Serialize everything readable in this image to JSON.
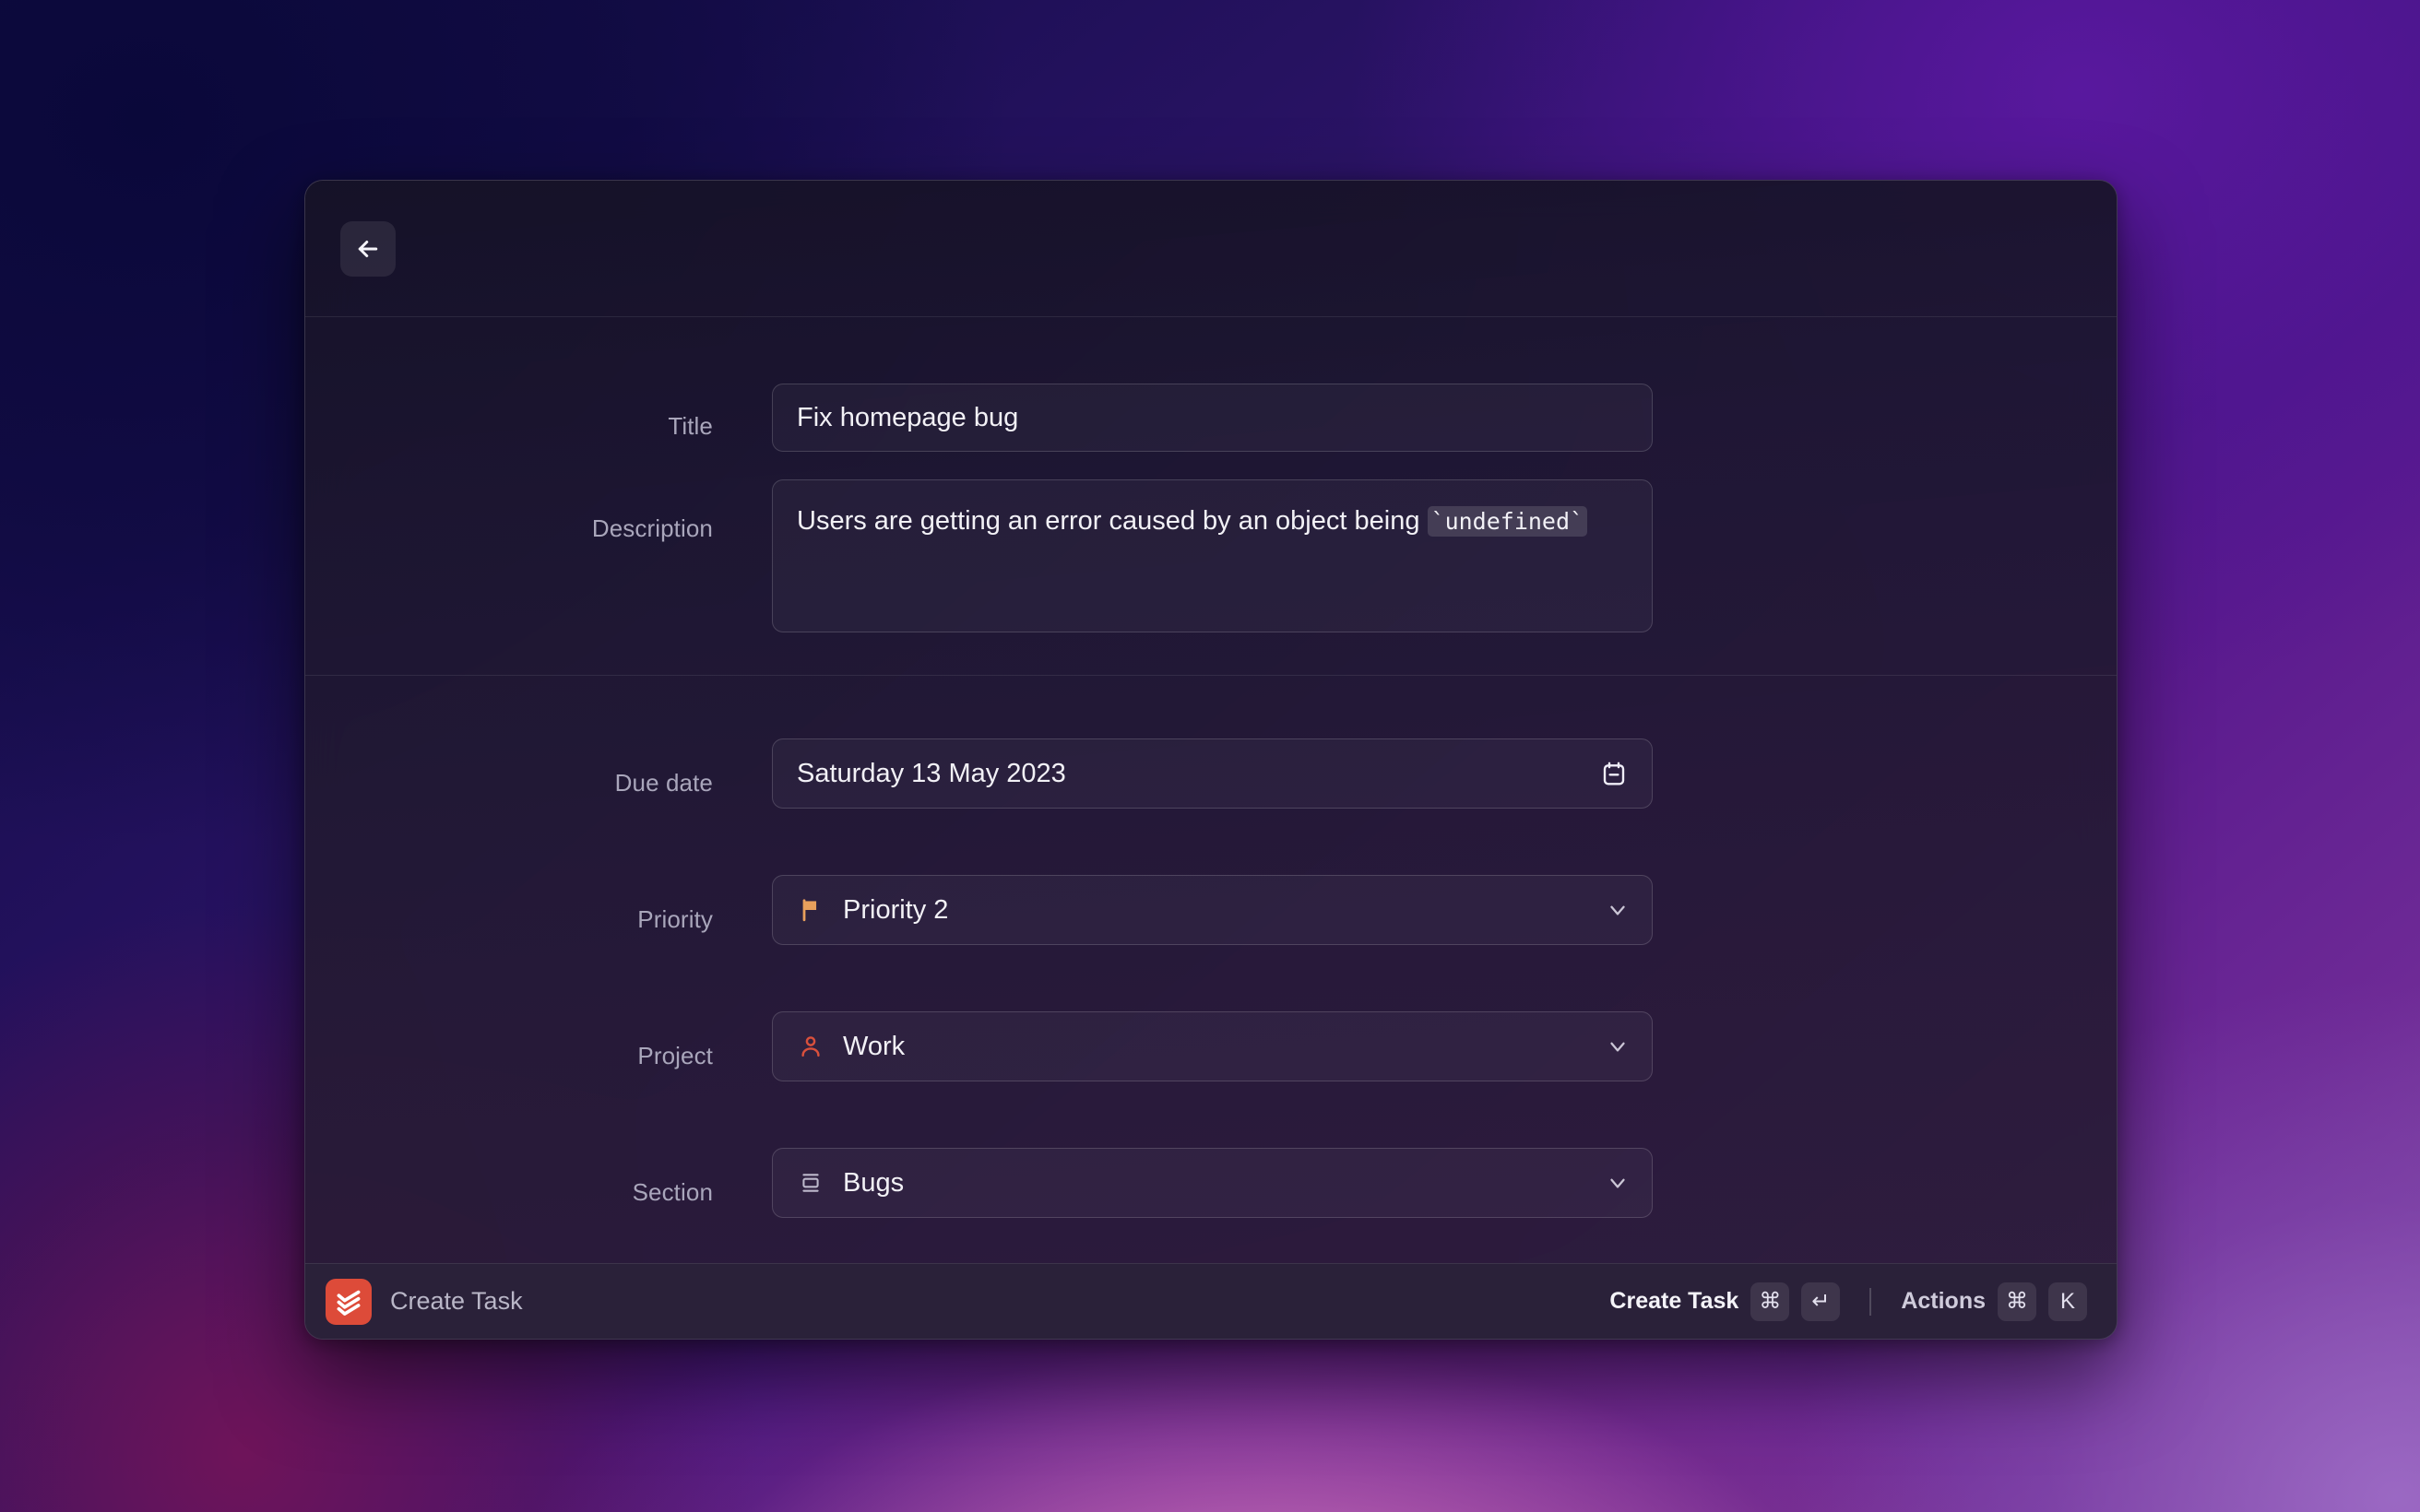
{
  "window": {
    "back_button_icon": "arrow-left-icon"
  },
  "form": {
    "title": {
      "label": "Title",
      "value": "Fix homepage bug",
      "placeholder": "Title"
    },
    "description": {
      "label": "Description",
      "value_before_code": "Users are getting an error caused by an object being ",
      "code_value": "`undefined`",
      "placeholder": "Description"
    },
    "due_date": {
      "label": "Due date",
      "value": "Saturday 13 May 2023",
      "icon": "calendar-icon"
    },
    "priority": {
      "label": "Priority",
      "value": "Priority 2",
      "icon": "flag-icon",
      "icon_color": "#e8a05c",
      "chevron": "chevron-down-icon"
    },
    "project": {
      "label": "Project",
      "value": "Work",
      "icon": "person-icon",
      "icon_color": "#d9503c",
      "chevron": "chevron-down-icon"
    },
    "section": {
      "label": "Section",
      "value": "Bugs",
      "icon": "section-box-icon",
      "icon_color": "#bdb9cc",
      "chevron": "chevron-down-icon"
    }
  },
  "footer": {
    "app_logo": "todoist-logo",
    "app_name": "Create Task",
    "primary_action": {
      "label": "Create Task",
      "keys": [
        "⌘",
        "↵"
      ]
    },
    "secondary_action": {
      "label": "Actions",
      "keys": [
        "⌘",
        "K"
      ]
    }
  },
  "colors": {
    "brand_orange": "#dd4b39",
    "priority_flag": "#e8a05c",
    "project_icon": "#d9503c",
    "window_bg": "#1f1930",
    "footer_bg": "#2a223a"
  }
}
